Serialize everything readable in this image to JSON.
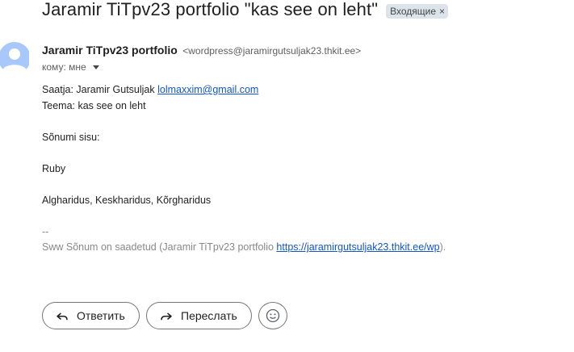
{
  "message": {
    "subject": "Jaramir TiTpv23 portfolio \"kas see on leht\"",
    "label_chip": "Входящие",
    "label_close": "×",
    "sender_name": "Jaramir TiTpv23 portfolio",
    "sender_email": "<wordpress@jaramirgutsuljak23.thkit.ee>",
    "to_line": "кому: мне"
  },
  "body": {
    "saatja_prefix": "Saatja: Jaramir Gutsuljak ",
    "saatja_email": "lolmaxxim@gmail.com",
    "teema": "Teema: kas see on leht",
    "sonumi_sisu": "Sõnumi sisu:",
    "line_ruby": "Ruby",
    "line_haridus": "Algharidus, Keskharidus, Kõrgharidus",
    "signature_dash": "--",
    "footer_prefix": "Sww Sõnum on saadetud (Jaramir TiTpv23 portfolio ",
    "footer_link": "https://jaramirgutsuljak23.thkit.ee/wp",
    "footer_suffix": ")."
  },
  "actions": {
    "reply_label": "Ответить",
    "forward_label": "Переслать"
  },
  "icons": {
    "avatar": "person-avatar-icon",
    "reply": "reply-arrow-icon",
    "forward": "forward-arrow-icon",
    "emoji": "smiley-icon",
    "dropdown": "caret-down-icon"
  },
  "colors": {
    "link": "#1155cc",
    "avatar": "#a8c7fa",
    "muted": "#888888"
  }
}
